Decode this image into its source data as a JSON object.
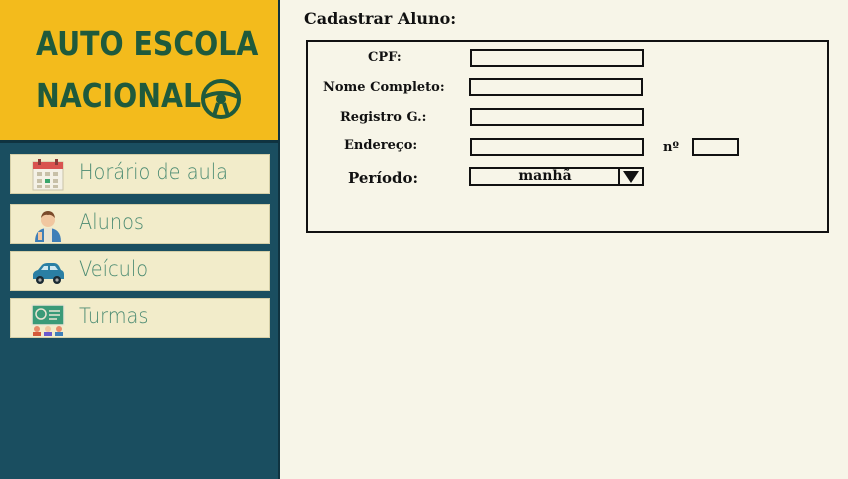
{
  "sidebar": {
    "logo": {
      "line1": "AUTO ESCOLA",
      "line2": "NACIONAL",
      "icon": "steering-wheel-icon"
    },
    "items": [
      {
        "label": "Horário de aula",
        "icon": "calendar-icon"
      },
      {
        "label": "Alunos",
        "icon": "student-icon"
      },
      {
        "label": "Veículo",
        "icon": "car-icon"
      },
      {
        "label": "Turmas",
        "icon": "classroom-icon"
      }
    ]
  },
  "form": {
    "title": "Cadastrar Aluno:",
    "cpf_label": "CPF:",
    "nome_label": "Nome Completo:",
    "rg_label": "Registro G.:",
    "endereco_label": "Endereço:",
    "numero_label": "nº",
    "periodo_label": "Período:",
    "periodo_value": "manhã"
  },
  "colors": {
    "sidebar_bg": "#1a4e60",
    "logo_bg": "#f3bb1c",
    "logo_text": "#1f5a3c",
    "nav_item_bg": "#f2ecca",
    "nav_text": "#4c8b72",
    "page_bg": "#f7f5e8"
  }
}
